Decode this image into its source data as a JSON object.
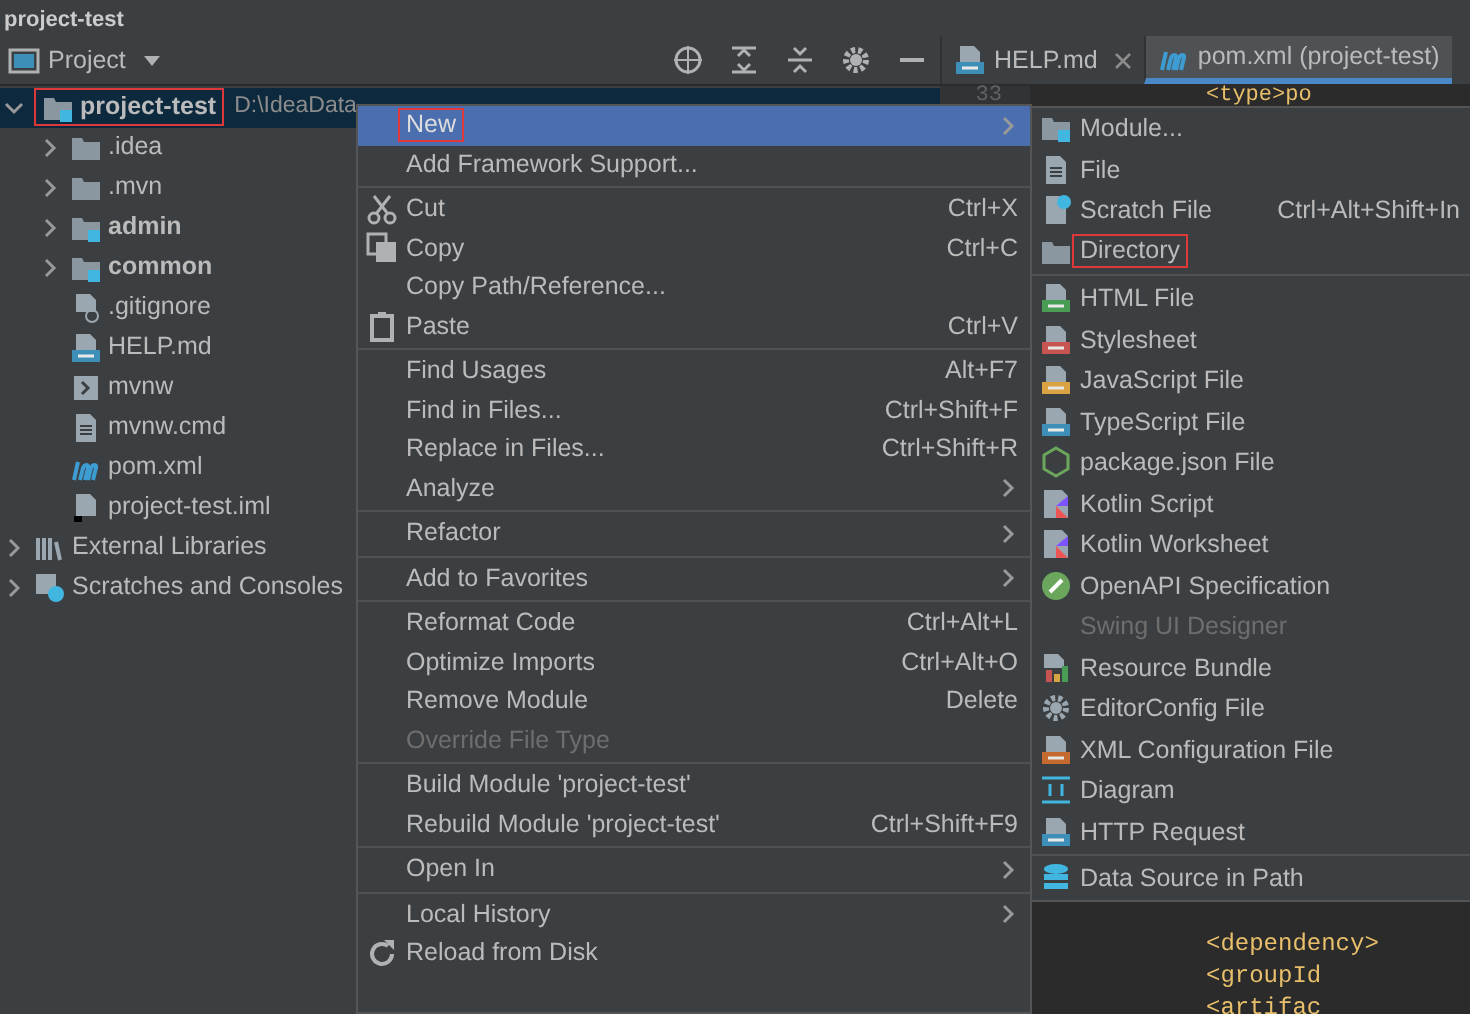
{
  "window": {
    "title": "project-test"
  },
  "project_panel": {
    "title": "Project"
  },
  "toolbar": [
    {
      "kind": "locate"
    },
    {
      "kind": "expand"
    },
    {
      "kind": "collapse"
    },
    {
      "kind": "settings"
    },
    {
      "kind": "minimize"
    }
  ],
  "tabs": [
    {
      "label": "HELP.md",
      "kind": "md",
      "closable": true,
      "selected": false
    },
    {
      "label": "pom.xml (project-test)",
      "kind": "maven",
      "closable": false,
      "selected": true
    }
  ],
  "tree": [
    {
      "label": "project-test",
      "path": "D:\\IdeaData",
      "kind": "module",
      "bold": true,
      "expanded": true,
      "selected": true,
      "highlighted": true,
      "children": [
        {
          "label": ".idea",
          "kind": "folder",
          "expanded": false
        },
        {
          "label": ".mvn",
          "kind": "folder",
          "expanded": false
        },
        {
          "label": "admin",
          "kind": "module",
          "bold": true,
          "expanded": false
        },
        {
          "label": "common",
          "kind": "module",
          "bold": true,
          "expanded": false
        },
        {
          "label": ".gitignore",
          "kind": "ignore"
        },
        {
          "label": "HELP.md",
          "kind": "md"
        },
        {
          "label": "mvnw",
          "kind": "shell"
        },
        {
          "label": "mvnw.cmd",
          "kind": "text"
        },
        {
          "label": "pom.xml",
          "kind": "maven"
        },
        {
          "label": "project-test.iml",
          "kind": "iml"
        }
      ]
    },
    {
      "label": "External Libraries",
      "kind": "libraries",
      "expanded": false
    },
    {
      "label": "Scratches and Consoles",
      "kind": "scratches",
      "expanded": false
    }
  ],
  "editor": {
    "line_number": "33",
    "top_lines": [
      "<type>po"
    ],
    "bottom_lines": [
      "<dependency>",
      "<groupId",
      "<artifac"
    ]
  },
  "context_menu": [
    [
      {
        "label": "New",
        "submenu": true,
        "selected": true,
        "highlighted": true
      },
      {
        "label": "Add Framework Support..."
      }
    ],
    [
      {
        "label": "Cut",
        "kind": "cut",
        "shortcut": "Ctrl+X"
      },
      {
        "label": "Copy",
        "kind": "copy",
        "shortcut": "Ctrl+C"
      },
      {
        "label": "Copy Path/Reference..."
      },
      {
        "label": "Paste",
        "kind": "paste",
        "shortcut": "Ctrl+V"
      }
    ],
    [
      {
        "label": "Find Usages",
        "shortcut": "Alt+F7"
      },
      {
        "label": "Find in Files...",
        "shortcut": "Ctrl+Shift+F"
      },
      {
        "label": "Replace in Files...",
        "shortcut": "Ctrl+Shift+R"
      },
      {
        "label": "Analyze",
        "submenu": true
      }
    ],
    [
      {
        "label": "Refactor",
        "submenu": true
      }
    ],
    [
      {
        "label": "Add to Favorites",
        "submenu": true
      }
    ],
    [
      {
        "label": "Reformat Code",
        "shortcut": "Ctrl+Alt+L"
      },
      {
        "label": "Optimize Imports",
        "shortcut": "Ctrl+Alt+O"
      },
      {
        "label": "Remove Module",
        "shortcut": "Delete"
      },
      {
        "label": "Override File Type",
        "disabled": true
      }
    ],
    [
      {
        "label": "Build Module 'project-test'"
      },
      {
        "label": "Rebuild Module 'project-test'",
        "shortcut": "Ctrl+Shift+F9"
      }
    ],
    [
      {
        "label": "Open In",
        "submenu": true
      }
    ],
    [
      {
        "label": "Local History",
        "submenu": true
      },
      {
        "label": "Reload from Disk",
        "kind": "reload"
      }
    ]
  ],
  "new_submenu": [
    [
      {
        "label": "Module...",
        "kind": "module"
      },
      {
        "label": "File",
        "kind": "text"
      },
      {
        "label": "Scratch File",
        "kind": "scratch",
        "shortcut": "Ctrl+Alt+Shift+In"
      },
      {
        "label": "Directory",
        "kind": "folder",
        "highlighted": true
      }
    ],
    [
      {
        "label": "HTML File",
        "kind": "html"
      },
      {
        "label": "Stylesheet",
        "kind": "css"
      },
      {
        "label": "JavaScript File",
        "kind": "js"
      },
      {
        "label": "TypeScript File",
        "kind": "ts"
      },
      {
        "label": "package.json File",
        "kind": "nodejs"
      },
      {
        "label": "Kotlin Script",
        "kind": "kotlin"
      },
      {
        "label": "Kotlin Worksheet",
        "kind": "kotlin"
      },
      {
        "label": "OpenAPI Specification",
        "kind": "openapi"
      },
      {
        "label": "Swing UI Designer",
        "disabled": true
      },
      {
        "label": "Resource Bundle",
        "kind": "bundle"
      },
      {
        "label": "EditorConfig File",
        "kind": "gear"
      },
      {
        "label": "XML Configuration File",
        "kind": "xml"
      },
      {
        "label": "Diagram",
        "kind": "diagram"
      },
      {
        "label": "HTTP Request",
        "kind": "api"
      }
    ],
    [
      {
        "label": "Data Source in Path",
        "kind": "database"
      }
    ]
  ]
}
